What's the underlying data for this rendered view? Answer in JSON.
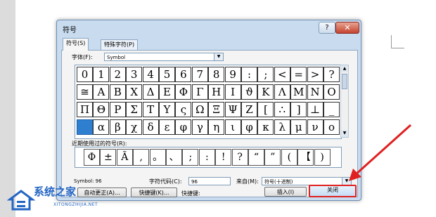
{
  "dialog": {
    "title": "符号",
    "help_label": "?",
    "close_label": "✕",
    "tabs": [
      {
        "label": "符号(S)"
      },
      {
        "label": "特殊字符(P)"
      }
    ],
    "font_label": "字体(F):",
    "font_value": "Symbol",
    "symbol_rows": [
      [
        "0",
        "1",
        "2",
        "3",
        "4",
        "5",
        "6",
        "7",
        "8",
        "9",
        ":",
        ";",
        "<",
        "=",
        ">",
        "?"
      ],
      [
        "≅",
        "Α",
        "Β",
        "Χ",
        "Δ",
        "Ε",
        "Φ",
        "Γ",
        "Η",
        "Ι",
        "ϑ",
        "Κ",
        "Λ",
        "Μ",
        "Ν",
        "Ο"
      ],
      [
        "Π",
        "Θ",
        "Ρ",
        "Σ",
        "Τ",
        "Υ",
        "ς",
        "Ω",
        "Ξ",
        "Ψ",
        "Ζ",
        "[",
        "∴",
        "]",
        "⊥",
        "_"
      ],
      [
        "",
        "α",
        "β",
        "χ",
        "δ",
        "ε",
        "φ",
        "γ",
        "η",
        "ι",
        "φ",
        "κ",
        "λ",
        "μ",
        "ν",
        "ο"
      ]
    ],
    "recent_label": "近期使用过的符号(R):",
    "recent_symbols": [
      "Φ",
      "±",
      "Ã",
      ",",
      "。",
      "、",
      ";",
      ":",
      "!",
      "?",
      "“",
      "”",
      "(",
      "【",
      ")"
    ],
    "charname_value": "Symbol: 96",
    "code_label": "字符代码(C):",
    "code_value": "96",
    "from_label": "来自(M):",
    "from_value": "符号(十进制)",
    "autocorrect_label": "自动更正(A)...",
    "shortcut_key_label": "快捷键(K)...",
    "shortcut_text_label": "快捷键:",
    "insert_label": "插入(I)",
    "close_button_label": "关闭"
  },
  "watermark": {
    "text": "系统之家",
    "sub": "XITONGZHIJIA.NET"
  },
  "colors": {
    "arrow": "#e02020",
    "selected_cell": "#2f7fd0",
    "watermark": "#2466c4"
  }
}
